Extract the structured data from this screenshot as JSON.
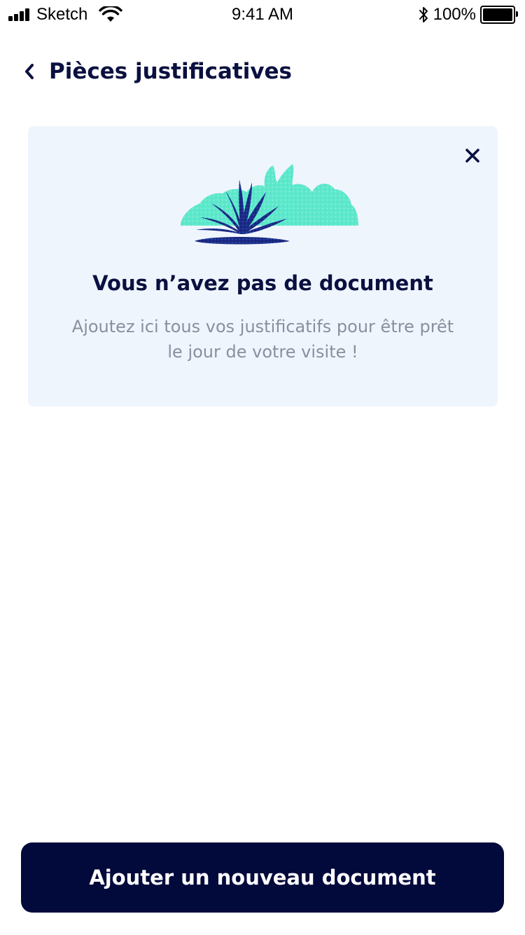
{
  "status_bar": {
    "carrier": "Sketch",
    "time": "9:41 AM",
    "battery_percent": "100%",
    "icons": [
      "signal-icon",
      "wifi-icon",
      "bluetooth-icon",
      "battery-icon"
    ]
  },
  "header": {
    "back_icon": "chevron-left-icon",
    "title": "Pièces justificatives"
  },
  "empty_state": {
    "close_icon": "close-icon",
    "illustration": "plant-illustration",
    "title": "Vous n’avez pas de document",
    "description": "Ajoutez ici tous vos justificatifs pour être prêt le jour de votre visite !"
  },
  "footer": {
    "add_button_label": "Ajouter un nouveau document"
  },
  "colors": {
    "primary_navy": "#02093b",
    "title_navy": "#0a1140",
    "card_background": "#eff5fd",
    "muted_text": "#8a8f9f",
    "illustration_mint": "#5ee8cc",
    "illustration_blue": "#1c2a86"
  }
}
